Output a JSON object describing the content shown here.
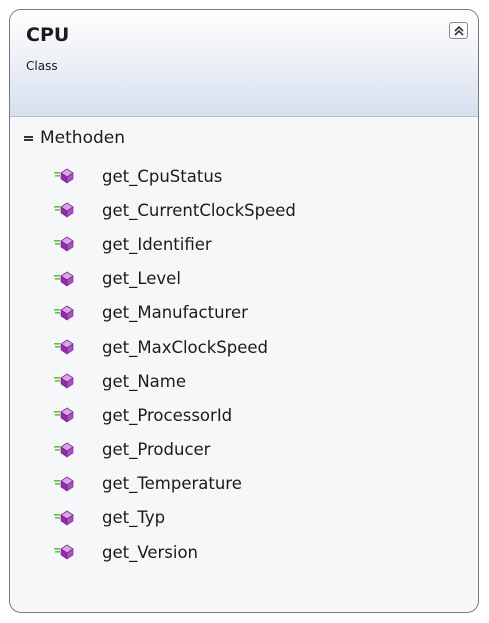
{
  "class": {
    "name": "CPU",
    "kind": "Class"
  },
  "section": {
    "label": "Methoden",
    "methods": [
      "get_CpuStatus",
      "get_CurrentClockSpeed",
      "get_Identifier",
      "get_Level",
      "get_Manufacturer",
      "get_MaxClockSpeed",
      "get_Name",
      "get_ProcessorId",
      "get_Producer",
      "get_Temperature",
      "get_Typ",
      "get_Version"
    ]
  },
  "colors": {
    "method_icon": "#a23fb8",
    "method_icon_lines": "#6bbf3a",
    "border": "#7a7a7a",
    "header_gradient_bottom": "#d6dfee"
  },
  "icons": {
    "collapse": "double-chevron-up-icon",
    "section_toggle": "collapse-minus-icon",
    "method": "method-icon"
  }
}
